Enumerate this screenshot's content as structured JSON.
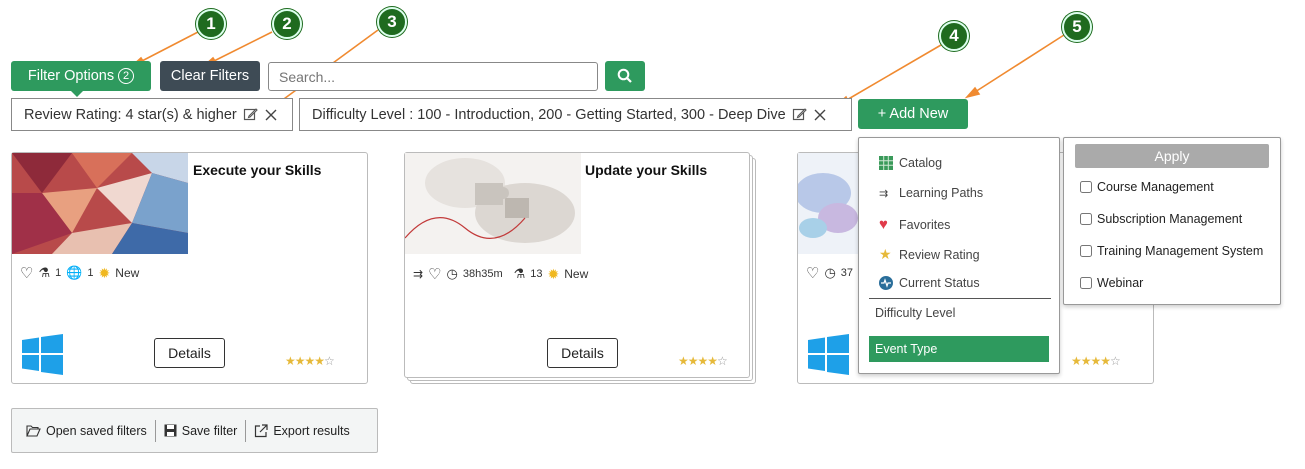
{
  "callouts": [
    "1",
    "2",
    "3",
    "4",
    "5"
  ],
  "toolbar": {
    "filter_options_label": "Filter Options",
    "filter_count": "2",
    "clear_filters_label": "Clear Filters",
    "search_placeholder": "Search..."
  },
  "active_filters": [
    {
      "label": "Review Rating: 4 star(s) & higher"
    },
    {
      "label": "Difficulty Level : 100 - Introduction, 200 - Getting Started, 300 - Deep Dive"
    }
  ],
  "add_new_label": "+ Add New",
  "cards": [
    {
      "title": "Execute your Skills",
      "count1": "1",
      "count2": "1",
      "new_label": "New",
      "details_label": "Details",
      "rating": 4
    },
    {
      "title": "Update your Skills",
      "duration": "38h35m",
      "count1": "13",
      "new_label": "New",
      "details_label": "Details",
      "rating": 4
    },
    {
      "count1": "37",
      "rating": 4
    }
  ],
  "add_new_menu": {
    "items": [
      {
        "label": "Catalog",
        "icon": "grid-icon"
      },
      {
        "label": "Learning Paths",
        "icon": "path-icon"
      },
      {
        "label": "Favorites",
        "icon": "heart-icon"
      },
      {
        "label": "Review Rating",
        "icon": "star-icon"
      },
      {
        "label": "Current Status",
        "icon": "status-icon"
      }
    ],
    "difficulty_label": "Difficulty Level",
    "event_type_label": "Event Type"
  },
  "event_type_menu": {
    "apply_label": "Apply",
    "options": [
      "Course Management",
      "Subscription Management",
      "Training Management System",
      "Webinar"
    ]
  },
  "bottom_bar": {
    "open_saved_label": "Open saved filters",
    "save_label": "Save filter",
    "export_label": "Export results"
  },
  "colors": {
    "green": "#2e9a5e",
    "dark": "#3e4b55",
    "callout": "#1f6b1f",
    "arrow": "#f08a30",
    "star": "#e6b93a"
  }
}
